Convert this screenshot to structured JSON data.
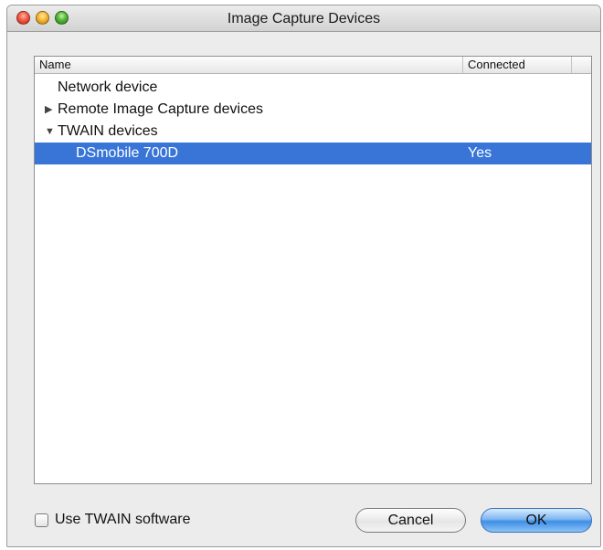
{
  "window": {
    "title": "Image Capture Devices"
  },
  "table": {
    "columns": [
      "Name",
      "Connected"
    ],
    "rows": [
      {
        "name": "Network device",
        "connected": "",
        "disclosure": "",
        "level": 0,
        "selected": false
      },
      {
        "name": "Remote Image Capture devices",
        "connected": "",
        "disclosure": "▶",
        "level": 0,
        "selected": false
      },
      {
        "name": "TWAIN devices",
        "connected": "",
        "disclosure": "▼",
        "level": 0,
        "selected": false
      },
      {
        "name": "DSmobile 700D",
        "connected": "Yes",
        "disclosure": "",
        "level": 1,
        "selected": true
      }
    ]
  },
  "footer": {
    "checkbox_label": "Use TWAIN software",
    "checkbox_checked": false,
    "cancel_label": "Cancel",
    "ok_label": "OK"
  },
  "colors": {
    "selection": "#3875d7",
    "ok_button": "#3f8ee6"
  }
}
